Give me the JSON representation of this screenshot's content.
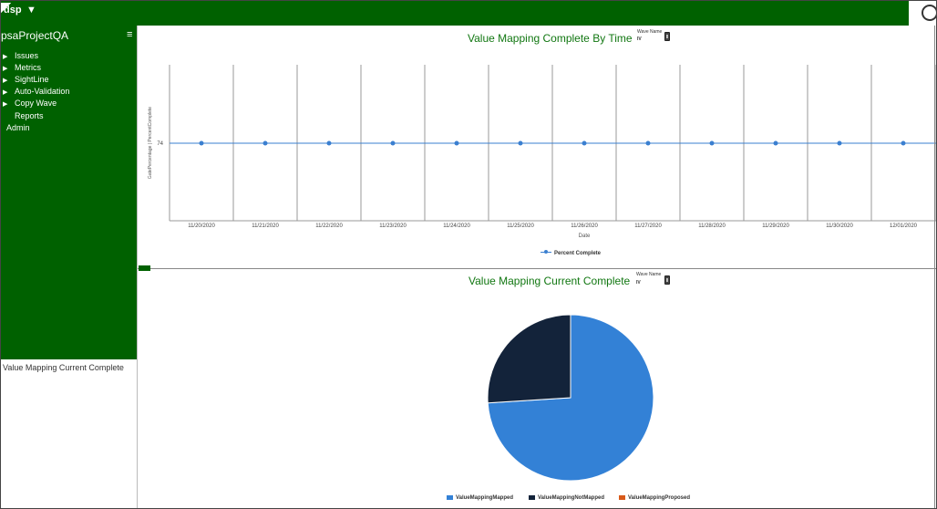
{
  "topbar": {
    "logo_text": "dsp",
    "dropdown_glyph": "▼"
  },
  "sidebar": {
    "title": "psaProjectQA",
    "menu_glyph": "≡",
    "items": [
      {
        "label": "Issues",
        "caret": "▶"
      },
      {
        "label": "Metrics",
        "caret": "▶"
      },
      {
        "label": "SightLine",
        "caret": "▶"
      },
      {
        "label": "Auto-Validation",
        "caret": "▶"
      },
      {
        "label": "Copy Wave",
        "caret": "▶"
      },
      {
        "label": "Reports",
        "caret": ""
      },
      {
        "label": "Admin",
        "caret": ""
      }
    ],
    "bottom_label": "Value Mapping Current Complete"
  },
  "line_panel": {
    "title": "Value Mapping Complete By Time",
    "wave_label": "Wave Name",
    "wave_value": "IV",
    "legend": "Percent Complete",
    "chart_data": {
      "type": "line",
      "x": [
        "11/20/2020",
        "11/21/2020",
        "11/22/2020",
        "11/23/2020",
        "11/24/2020",
        "11/25/2020",
        "11/26/2020",
        "11/27/2020",
        "11/28/2020",
        "11/29/2020",
        "11/30/2020",
        "12/01/2020"
      ],
      "series": [
        {
          "name": "Percent Complete",
          "values": [
            74,
            74,
            74,
            74,
            74,
            74,
            74,
            74,
            74,
            74,
            74,
            74
          ]
        }
      ],
      "y_ticks": [
        "74"
      ],
      "xlabel": "Date",
      "ylabel": "GatePercentage | PercentComplete",
      "color": "#3a7fd0"
    }
  },
  "pie_panel": {
    "title": "Value Mapping Current Complete",
    "wave_label": "Wave Name",
    "wave_value": "IV",
    "chart_data": {
      "type": "pie",
      "categories": [
        "ValueMappingMapped",
        "ValueMappingNotMapped",
        "ValueMappingProposed"
      ],
      "values": [
        74,
        26,
        0
      ],
      "colors": [
        "#3381d6",
        "#13233a",
        "#d85a1a"
      ]
    }
  }
}
